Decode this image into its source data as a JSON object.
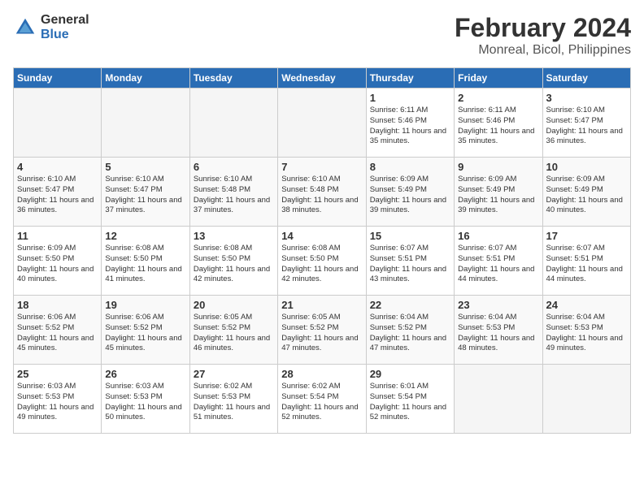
{
  "header": {
    "logo_general": "General",
    "logo_blue": "Blue",
    "month": "February 2024",
    "location": "Monreal, Bicol, Philippines"
  },
  "days_of_week": [
    "Sunday",
    "Monday",
    "Tuesday",
    "Wednesday",
    "Thursday",
    "Friday",
    "Saturday"
  ],
  "weeks": [
    [
      {
        "day": "",
        "empty": true
      },
      {
        "day": "",
        "empty": true
      },
      {
        "day": "",
        "empty": true
      },
      {
        "day": "",
        "empty": true
      },
      {
        "day": "1",
        "sunrise": "6:11 AM",
        "sunset": "5:46 PM",
        "daylight": "11 hours and 35 minutes."
      },
      {
        "day": "2",
        "sunrise": "6:11 AM",
        "sunset": "5:46 PM",
        "daylight": "11 hours and 35 minutes."
      },
      {
        "day": "3",
        "sunrise": "6:10 AM",
        "sunset": "5:47 PM",
        "daylight": "11 hours and 36 minutes."
      }
    ],
    [
      {
        "day": "4",
        "sunrise": "6:10 AM",
        "sunset": "5:47 PM",
        "daylight": "11 hours and 36 minutes."
      },
      {
        "day": "5",
        "sunrise": "6:10 AM",
        "sunset": "5:47 PM",
        "daylight": "11 hours and 37 minutes."
      },
      {
        "day": "6",
        "sunrise": "6:10 AM",
        "sunset": "5:48 PM",
        "daylight": "11 hours and 37 minutes."
      },
      {
        "day": "7",
        "sunrise": "6:10 AM",
        "sunset": "5:48 PM",
        "daylight": "11 hours and 38 minutes."
      },
      {
        "day": "8",
        "sunrise": "6:09 AM",
        "sunset": "5:49 PM",
        "daylight": "11 hours and 39 minutes."
      },
      {
        "day": "9",
        "sunrise": "6:09 AM",
        "sunset": "5:49 PM",
        "daylight": "11 hours and 39 minutes."
      },
      {
        "day": "10",
        "sunrise": "6:09 AM",
        "sunset": "5:49 PM",
        "daylight": "11 hours and 40 minutes."
      }
    ],
    [
      {
        "day": "11",
        "sunrise": "6:09 AM",
        "sunset": "5:50 PM",
        "daylight": "11 hours and 40 minutes."
      },
      {
        "day": "12",
        "sunrise": "6:08 AM",
        "sunset": "5:50 PM",
        "daylight": "11 hours and 41 minutes."
      },
      {
        "day": "13",
        "sunrise": "6:08 AM",
        "sunset": "5:50 PM",
        "daylight": "11 hours and 42 minutes."
      },
      {
        "day": "14",
        "sunrise": "6:08 AM",
        "sunset": "5:50 PM",
        "daylight": "11 hours and 42 minutes."
      },
      {
        "day": "15",
        "sunrise": "6:07 AM",
        "sunset": "5:51 PM",
        "daylight": "11 hours and 43 minutes."
      },
      {
        "day": "16",
        "sunrise": "6:07 AM",
        "sunset": "5:51 PM",
        "daylight": "11 hours and 44 minutes."
      },
      {
        "day": "17",
        "sunrise": "6:07 AM",
        "sunset": "5:51 PM",
        "daylight": "11 hours and 44 minutes."
      }
    ],
    [
      {
        "day": "18",
        "sunrise": "6:06 AM",
        "sunset": "5:52 PM",
        "daylight": "11 hours and 45 minutes."
      },
      {
        "day": "19",
        "sunrise": "6:06 AM",
        "sunset": "5:52 PM",
        "daylight": "11 hours and 45 minutes."
      },
      {
        "day": "20",
        "sunrise": "6:05 AM",
        "sunset": "5:52 PM",
        "daylight": "11 hours and 46 minutes."
      },
      {
        "day": "21",
        "sunrise": "6:05 AM",
        "sunset": "5:52 PM",
        "daylight": "11 hours and 47 minutes."
      },
      {
        "day": "22",
        "sunrise": "6:04 AM",
        "sunset": "5:52 PM",
        "daylight": "11 hours and 47 minutes."
      },
      {
        "day": "23",
        "sunrise": "6:04 AM",
        "sunset": "5:53 PM",
        "daylight": "11 hours and 48 minutes."
      },
      {
        "day": "24",
        "sunrise": "6:04 AM",
        "sunset": "5:53 PM",
        "daylight": "11 hours and 49 minutes."
      }
    ],
    [
      {
        "day": "25",
        "sunrise": "6:03 AM",
        "sunset": "5:53 PM",
        "daylight": "11 hours and 49 minutes."
      },
      {
        "day": "26",
        "sunrise": "6:03 AM",
        "sunset": "5:53 PM",
        "daylight": "11 hours and 50 minutes."
      },
      {
        "day": "27",
        "sunrise": "6:02 AM",
        "sunset": "5:53 PM",
        "daylight": "11 hours and 51 minutes."
      },
      {
        "day": "28",
        "sunrise": "6:02 AM",
        "sunset": "5:54 PM",
        "daylight": "11 hours and 52 minutes."
      },
      {
        "day": "29",
        "sunrise": "6:01 AM",
        "sunset": "5:54 PM",
        "daylight": "11 hours and 52 minutes."
      },
      {
        "day": "",
        "empty": true
      },
      {
        "day": "",
        "empty": true
      }
    ]
  ],
  "labels": {
    "sunrise": "Sunrise:",
    "sunset": "Sunset:",
    "daylight": "Daylight:"
  }
}
